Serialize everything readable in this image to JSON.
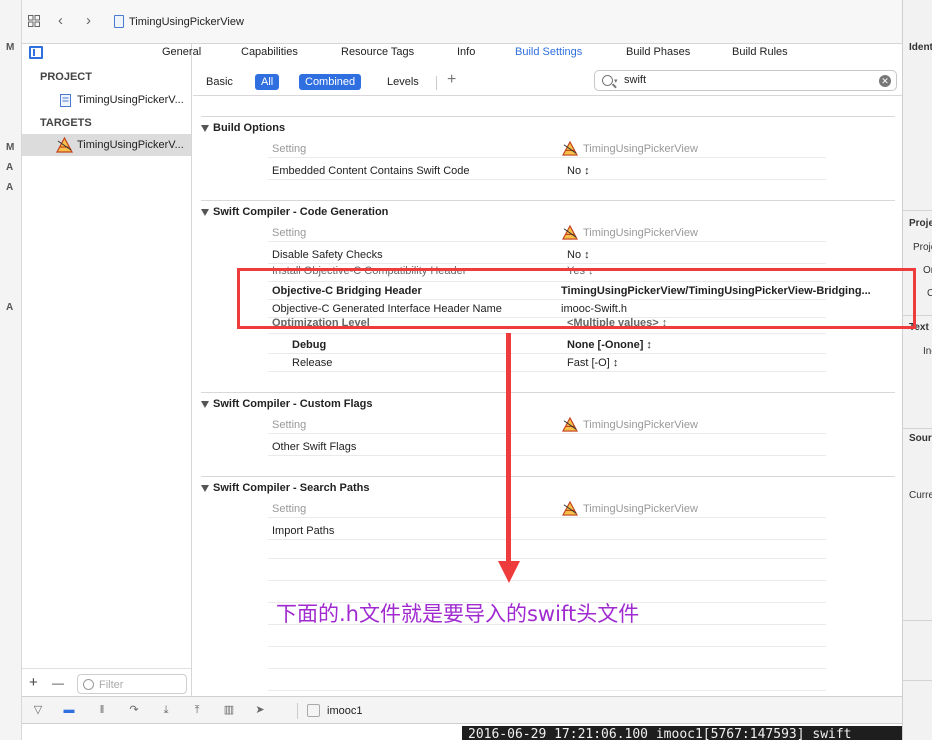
{
  "gutter_marks": [
    "M",
    "M",
    "A",
    "A",
    "A"
  ],
  "jumpbar": {
    "back_icon": "chevron-left-icon",
    "forward_icon": "chevron-right-icon",
    "crumb": "TimingUsingPickerView"
  },
  "navigator": {
    "project_header": "PROJECT",
    "project_item": "TimingUsingPickerV...",
    "targets_header": "TARGETS",
    "target_item": "TimingUsingPickerV...",
    "filter_placeholder": "Filter",
    "add_label": "+",
    "remove_label": "—"
  },
  "tabs": [
    {
      "label": "General",
      "active": false
    },
    {
      "label": "Capabilities",
      "active": false
    },
    {
      "label": "Resource Tags",
      "active": false
    },
    {
      "label": "Info",
      "active": false
    },
    {
      "label": "Build Settings",
      "active": true
    },
    {
      "label": "Build Phases",
      "active": false
    },
    {
      "label": "Build Rules",
      "active": false
    }
  ],
  "filterbar": {
    "basic": "Basic",
    "all": "All",
    "combined": "Combined",
    "levels": "Levels",
    "add": "+",
    "search_value": "swift"
  },
  "sections": [
    {
      "title": "Build Options",
      "header": {
        "setting": "Setting",
        "target": "TimingUsingPickerView"
      },
      "rows": [
        {
          "key": "Embedded Content Contains Swift Code",
          "value": "No ↕"
        }
      ]
    },
    {
      "title": "Swift Compiler - Code Generation",
      "header": {
        "setting": "Setting",
        "target": "TimingUsingPickerView"
      },
      "rows": [
        {
          "key": "Disable Safety Checks",
          "value": "No ↕"
        },
        {
          "key": "Install Objective-C Compatibility Header",
          "value": "Yes ↕"
        },
        {
          "key": "Objective-C Bridging Header",
          "value": "TimingUsingPickerView/TimingUsingPickerView-Bridging..."
        },
        {
          "key": "Objective-C Generated Interface Header Name",
          "value": "imooc-Swift.h"
        },
        {
          "key": "Optimization Level",
          "value": "<Multiple values> ↕"
        },
        {
          "key": "Debug",
          "value": "None [-Onone] ↕"
        },
        {
          "key": "Release",
          "value": "Fast [-O] ↕"
        }
      ]
    },
    {
      "title": "Swift Compiler - Custom Flags",
      "header": {
        "setting": "Setting",
        "target": "TimingUsingPickerView"
      },
      "rows": [
        {
          "key": "Other Swift Flags",
          "value": ""
        }
      ]
    },
    {
      "title": "Swift Compiler - Search Paths",
      "header": {
        "setting": "Setting",
        "target": "TimingUsingPickerView"
      },
      "rows": [
        {
          "key": "Import Paths",
          "value": ""
        }
      ]
    }
  ],
  "annotation": {
    "caption": "下面的.h文件就是要导入的swift头文件",
    "color": "#a02ad0",
    "box_color": "#ee3b3b"
  },
  "debugbar": {
    "process": "imooc1"
  },
  "console": {
    "line": "2016-06-29 17:21:06.100 imooc1[5767:147593] swift"
  },
  "inspector": {
    "labels": [
      "Ident",
      "Proje",
      "Proje",
      "On",
      "C",
      "Text",
      "Ind",
      "Sour",
      "Curre"
    ]
  },
  "colors": {
    "accent": "#2f6fe0",
    "annotation_red": "#ee3b3b"
  }
}
